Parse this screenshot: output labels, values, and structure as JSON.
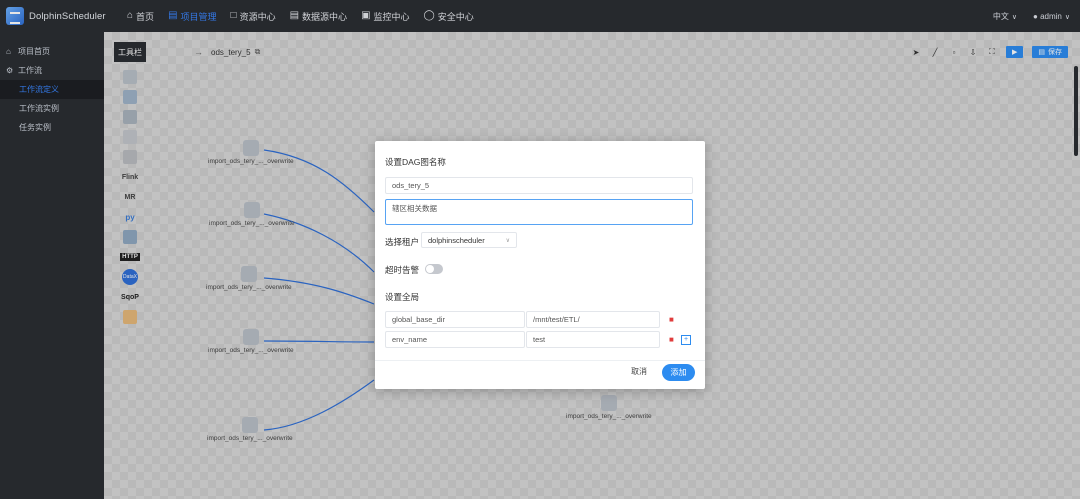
{
  "header": {
    "brand": "DolphinScheduler",
    "nav": [
      {
        "label": "首页",
        "icon": "home-icon"
      },
      {
        "label": "项目管理",
        "icon": "project-icon"
      },
      {
        "label": "资源中心",
        "icon": "folder-icon"
      },
      {
        "label": "数据源中心",
        "icon": "database-icon"
      },
      {
        "label": "监控中心",
        "icon": "monitor-icon"
      },
      {
        "label": "安全中心",
        "icon": "shield-icon"
      }
    ],
    "language": "中文",
    "user": "admin"
  },
  "sidebar": {
    "items": [
      {
        "label": "项目首页",
        "icon": "home-icon"
      },
      {
        "label": "工作流",
        "icon": "gear-icon"
      },
      {
        "label": "工作流定义"
      },
      {
        "label": "工作流实例"
      },
      {
        "label": "任务实例"
      }
    ]
  },
  "canvas": {
    "toolbox_title": "工具栏",
    "dag_name": "ods_tery_5",
    "tools": [
      "shell-icon",
      "sub-process-icon",
      "procedure-icon",
      "sql-icon",
      "spark-icon",
      "Flink",
      "MR",
      "py",
      "dependent-icon",
      "HTTP",
      "DataX",
      "SqoP",
      "conditions-icon"
    ],
    "run_btn": "▶",
    "save_btn": "保存",
    "nodes": [
      {
        "label": "import_ods_tery_..._overwrite"
      },
      {
        "label": "import_ods_tery_..._overwrite"
      },
      {
        "label": "import_ods_tery_..._overwrite"
      },
      {
        "label": "import_ods_tery_..._overwrite"
      },
      {
        "label": "import_ods_tery_..._overwrite"
      },
      {
        "label": "import_ods_tery_..._overwrite"
      }
    ]
  },
  "modal": {
    "title": "设置DAG图名称",
    "name_value": "ods_tery_5",
    "desc_value": "辖区相关数据",
    "tenant_label": "选择租户",
    "tenant_value": "dolphinscheduler",
    "timeout_label": "超时告警",
    "global_label": "设置全局",
    "params": [
      {
        "key": "global_base_dir",
        "value": "/mnt/test/ETL/"
      },
      {
        "key": "env_name",
        "value": "test"
      }
    ],
    "cancel": "取消",
    "add": "添加"
  }
}
